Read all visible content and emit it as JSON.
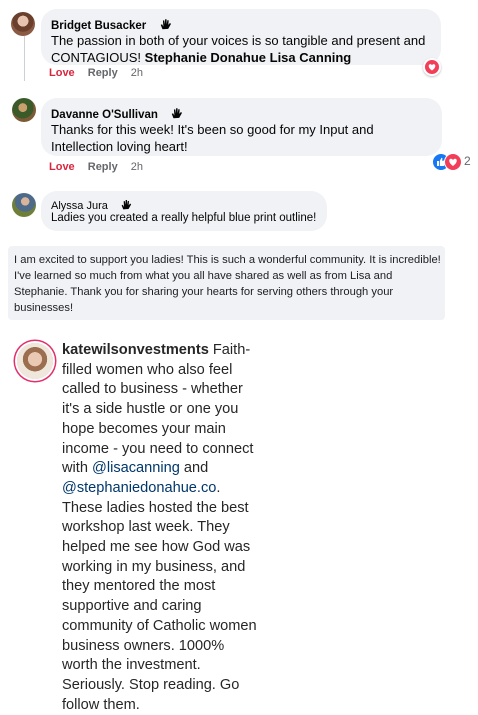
{
  "comments": [
    {
      "author": "Bridget Busacker",
      "text": "The passion in both of your voices is so tangible and present and CONTAGIOUS!",
      "tags": "Stephanie Donahue Lisa Canning",
      "love_label": "Love",
      "reply_label": "Reply",
      "time": "2h",
      "reaction": "love"
    },
    {
      "author": "Davanne O'Sullivan",
      "text": "Thanks for this week! It's been so good for my Input and Intellection loving heart!",
      "love_label": "Love",
      "reply_label": "Reply",
      "time": "2h",
      "reaction": "like-love",
      "reaction_count": "2"
    },
    {
      "author": "Alyssa Jura",
      "text": "Ladies you created a really helpful blue print outline!"
    }
  ],
  "standalone_comment": {
    "text": "I am excited to support you ladies! This is such a wonderful community. It is incredible! I've learned so much from what you all have shared as well as from Lisa and Stephanie. Thank you for sharing your hearts for serving others through your businesses!"
  },
  "instagram": {
    "username": "katewilsonvestments",
    "text_a": "Faith-filled women who also feel called to business - whether it's a side hustle or one you hope becomes your main income - you need to connect with",
    "mention1": "@lisacanning",
    "and": "and",
    "mention2": "@stephaniedonahue.co",
    "text_b": ". These ladies hosted the best workshop last week. They helped me see how God was working in my business, and they mentored the most supportive and caring community of Catholic women business owners. 1000% worth the investment. Seriously. Stop reading. Go follow them."
  },
  "colors": {
    "love": "#d9263f",
    "bubble": "#f0f2f5",
    "link": "#00376b",
    "meta": "#65676b",
    "like": "#1877f2"
  },
  "icons": [
    "wave-hand-icon",
    "love-reaction-icon",
    "like-reaction-icon"
  ]
}
